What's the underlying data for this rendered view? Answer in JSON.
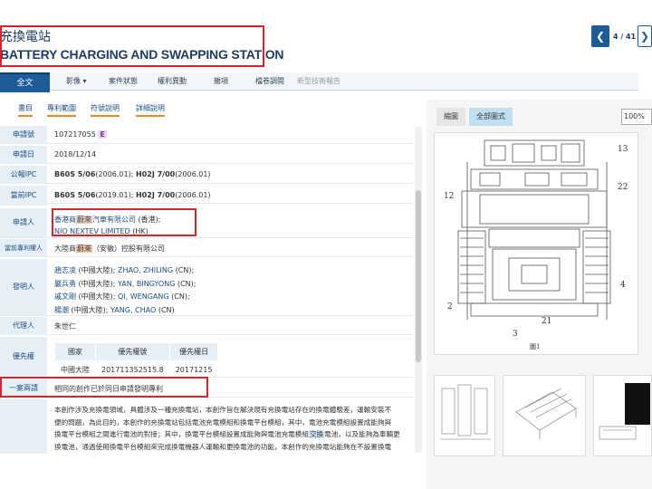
{
  "header": {
    "title_zh": "充換電站",
    "title_en": "BATTERY CHARGING AND SWAPPING STATION",
    "pager_text": "4 / 41",
    "prev_icon": "chevron-left-icon",
    "next_icon": "chevron-right-icon"
  },
  "tabs": [
    {
      "label": "全文",
      "active": true
    },
    {
      "label": "影像 ▾"
    },
    {
      "label": "案件狀態"
    },
    {
      "label": "權利異動"
    },
    {
      "label": "雜項"
    },
    {
      "label": "檔卷調閱"
    },
    {
      "label": "新型技術報告"
    }
  ],
  "subtabs": [
    "書目",
    "專利範圍",
    "符號說明",
    "詳細說明"
  ],
  "fields": {
    "app_no_label": "申請號",
    "app_no": "107217055",
    "app_no_badge": "E",
    "app_date_label": "申請日",
    "app_date": "2018/12/14",
    "pub_ipc_label": "公報IPC",
    "pub_ipc_1": "B60S 5/06",
    "pub_ipc_1_date": "(2006.01);",
    "pub_ipc_2": "H02J 7/00",
    "pub_ipc_2_date": "(2006.01)",
    "cur_ipc_label": "當前IPC",
    "cur_ipc_1": "B60S 5/06",
    "cur_ipc_1_date": "(2019.01);",
    "cur_ipc_2": "H02J 7/00",
    "cur_ipc_2_date": "(2006.01)",
    "applicant_label": "申請人",
    "applicant_1a": "香港商",
    "applicant_1hl": "蔚來",
    "applicant_1b": "汽車有限公司",
    "applicant_1c": "(香港);",
    "applicant_2": "NIO NEXTEV LIMITED",
    "applicant_2b": "(HK)",
    "owner_label": "當前專利權人",
    "owner_a": "大陸商",
    "owner_hl": "蔚來",
    "owner_b": "（安徽）控股有限公司",
    "inventor_label": "發明人",
    "inventors": [
      {
        "zh": "趙志凌",
        "note": "(中國大陸);",
        "en": "ZHAO, ZHILING",
        "tail": "(CN);"
      },
      {
        "zh": "嚴兵勇",
        "note": "(中國大陸);",
        "en": "YAN, BINGYONG",
        "tail": "(CN);"
      },
      {
        "zh": "戚文剛",
        "note": "(中國大陸);",
        "en": "QI, WENGANG",
        "tail": "(CN);"
      },
      {
        "zh": "楊潮",
        "note": "(中國大陸);",
        "en": "YANG, CHAO",
        "tail": "(CN)"
      }
    ],
    "agent_label": "代理人",
    "agent": "朱世仁",
    "priority_label": "優先權",
    "priority_headers": [
      "國家",
      "優先權號",
      "優先權日"
    ],
    "priority_row": [
      "中國大陸",
      "201711352515.8",
      "20171215"
    ],
    "same_day_label": "一案兩請",
    "same_day": "相同的創作已於同日申請發明專利",
    "abstract_lines": [
      "本創作涉及充換電領域，具體涉及一種充換電站，本創作旨在解決現有充換電站存在的換電體驗差，運輸安裝不",
      "便的問題，為此目的，本創作的充換電站包括電池充電模組和換電平台模組，其中，電池充電模組設置成能夠與",
      "換電平台模組之間進行電池的對接；其中，換電平台模組設置成能夠與電池充電模組",
      "換電池，通過使用換電平台模組來完成換電機器人運輸和更換電池的功能，本創作的充換電站能夠在不設置換電"
    ],
    "abstract_hl": "交換",
    "abstract_line3_tail": "電池，以及能夠為車輛更"
  },
  "right_panel": {
    "tab_1": "縮圖",
    "tab_2": "全部圖式",
    "zoom": "100%",
    "figure_labels": [
      "13",
      "12",
      "22",
      "4",
      "2",
      "3",
      "21"
    ],
    "figure_caption": "圖1"
  },
  "colors": {
    "accent": "#1c5d99",
    "highlight_box": "#d8232a",
    "subtab_underline": "#e68a2e",
    "label_bg": "#e6eef6"
  }
}
